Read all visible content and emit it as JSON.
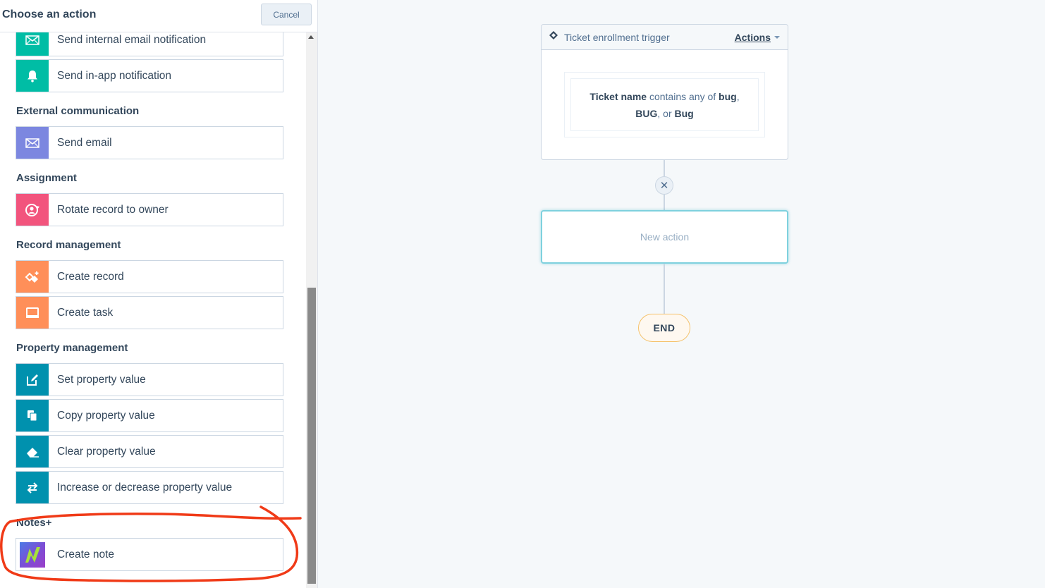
{
  "panel": {
    "title": "Choose an action",
    "cancel_label": "Cancel"
  },
  "sections": {
    "external": "External communication",
    "assignment": "Assignment",
    "record_mgmt": "Record management",
    "property_mgmt": "Property management",
    "notes_plus": "Notes+"
  },
  "actions": {
    "send_internal_email": {
      "label": "Send internal email notification",
      "icon": "envelope-icon",
      "color": "#00bda5"
    },
    "send_inapp": {
      "label": "Send in-app notification",
      "icon": "bell-icon",
      "color": "#00bda5"
    },
    "send_email": {
      "label": "Send email",
      "icon": "envelope-icon",
      "color": "#7c87e0"
    },
    "rotate_owner": {
      "label": "Rotate record to owner",
      "icon": "rotate-user-icon",
      "color": "#f2547d"
    },
    "create_record": {
      "label": "Create record",
      "icon": "create-record-icon",
      "color": "#ff8f59"
    },
    "create_task": {
      "label": "Create task",
      "icon": "task-icon",
      "color": "#ff8f59"
    },
    "set_property": {
      "label": "Set property value",
      "icon": "edit-icon",
      "color": "#0091ae"
    },
    "copy_property": {
      "label": "Copy property value",
      "icon": "copy-icon",
      "color": "#0091ae"
    },
    "clear_property": {
      "label": "Clear property value",
      "icon": "eraser-icon",
      "color": "#0091ae"
    },
    "increase_property": {
      "label": "Increase or decrease property value",
      "icon": "swap-arrows-icon",
      "color": "#0091ae"
    },
    "create_note": {
      "label": "Create note",
      "icon": "notes-plus-logo-icon"
    }
  },
  "workflow": {
    "trigger_title": "Ticket enrollment trigger",
    "actions_link": "Actions",
    "filter": {
      "property": "Ticket name",
      "operator": "contains any of",
      "value1": "bug",
      "sep1": ",",
      "value2": "BUG",
      "sep2": ", or",
      "value3": "Bug"
    },
    "remove_symbol": "✕",
    "new_action_placeholder": "New action",
    "end_label": "END"
  },
  "colors": {
    "annotation": "#f03a17",
    "new_action_border": "#7fd1de",
    "end_border": "#f5c26b"
  }
}
